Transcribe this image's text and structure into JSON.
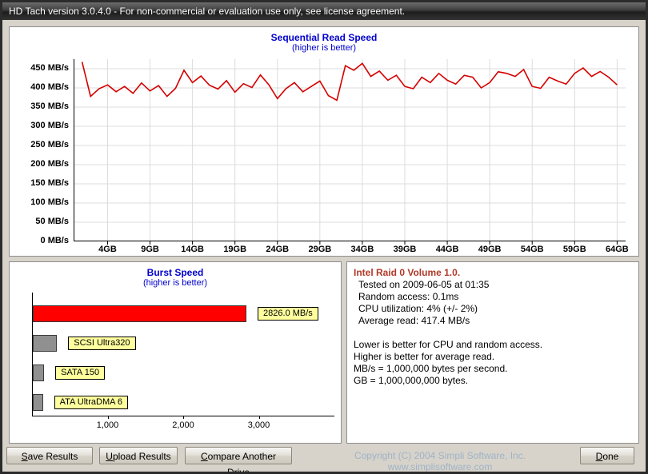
{
  "window": {
    "title": "HD Tach version 3.0.4.0  - For non-commercial or evaluation use only, see license agreement."
  },
  "chart_data": [
    {
      "type": "line",
      "title": "Sequential Read Speed",
      "subtitle": "(higher is better)",
      "line_color": "#d40000",
      "ylim": [
        0,
        475
      ],
      "xlim_gb": [
        0,
        65
      ],
      "y_ticks": [
        0,
        50,
        100,
        150,
        200,
        250,
        300,
        350,
        400,
        450
      ],
      "y_tick_suffix": " MB/s",
      "x_tick_gb": [
        4,
        9,
        14,
        19,
        24,
        29,
        34,
        39,
        44,
        49,
        54,
        59,
        64
      ],
      "x_tick_labels": [
        "4GB",
        "9GB",
        "14GB",
        "19GB",
        "24GB",
        "29GB",
        "34GB",
        "39GB",
        "44GB",
        "49GB",
        "54GB",
        "59GB",
        "64GB"
      ],
      "x_gb": [
        1,
        2,
        3,
        4,
        5,
        6,
        7,
        8,
        9,
        10,
        11,
        12,
        13,
        14,
        15,
        16,
        17,
        18,
        19,
        20,
        21,
        22,
        23,
        24,
        25,
        26,
        27,
        28,
        29,
        30,
        31,
        32,
        33,
        34,
        35,
        36,
        37,
        38,
        39,
        40,
        41,
        42,
        43,
        44,
        45,
        46,
        47,
        48,
        49,
        50,
        51,
        52,
        53,
        54,
        55,
        56,
        57,
        58,
        59,
        60,
        61,
        62,
        63,
        64
      ],
      "values": [
        468,
        378,
        398,
        408,
        390,
        404,
        386,
        413,
        392,
        406,
        378,
        399,
        446,
        414,
        431,
        407,
        397,
        419,
        389,
        411,
        401,
        434,
        408,
        372,
        398,
        414,
        390,
        404,
        418,
        380,
        368,
        458,
        446,
        464,
        430,
        444,
        420,
        433,
        404,
        398,
        428,
        414,
        438,
        420,
        410,
        433,
        428,
        400,
        414,
        442,
        438,
        430,
        448,
        404,
        399,
        428,
        418,
        410,
        438,
        452,
        430,
        443,
        428,
        408
      ]
    },
    {
      "type": "bar",
      "orientation": "horizontal",
      "title": "Burst Speed",
      "subtitle": "(higher is better)",
      "xlim": [
        0,
        4000
      ],
      "x_ticks": [
        {
          "value": 1000,
          "label": "1,000"
        },
        {
          "value": 2000,
          "label": "2,000"
        },
        {
          "value": 3000,
          "label": "3,000"
        }
      ],
      "bars": [
        {
          "label": "2826.0 MB/s",
          "value": 2826,
          "color": "#ff0000"
        },
        {
          "label": "SCSI Ultra320",
          "value": 320,
          "color": "#909090"
        },
        {
          "label": "SATA 150",
          "value": 150,
          "color": "#909090"
        },
        {
          "label": "ATA UltraDMA 6",
          "value": 133,
          "color": "#909090"
        }
      ]
    }
  ],
  "info": {
    "title": "Intel Raid 0 Volume 1.0.",
    "details": [
      "Tested on 2009-06-05 at 01:35",
      "Random access: 0.1ms",
      "CPU utilization: 4% (+/- 2%)",
      "Average read: 417.4 MB/s"
    ],
    "notes": [
      "Lower is better for CPU and random access.",
      "Higher is better for average read.",
      "MB/s = 1,000,000 bytes per second.",
      "GB = 1,000,000,000 bytes."
    ]
  },
  "footer": {
    "buttons": [
      {
        "label": "Save Results"
      },
      {
        "label": "Upload Results"
      },
      {
        "label": "Compare Another Drive"
      }
    ],
    "done_label": "Done",
    "copyright": "Copyright (C) 2004 Simpli Software, Inc. www.simplisoftware.com"
  }
}
